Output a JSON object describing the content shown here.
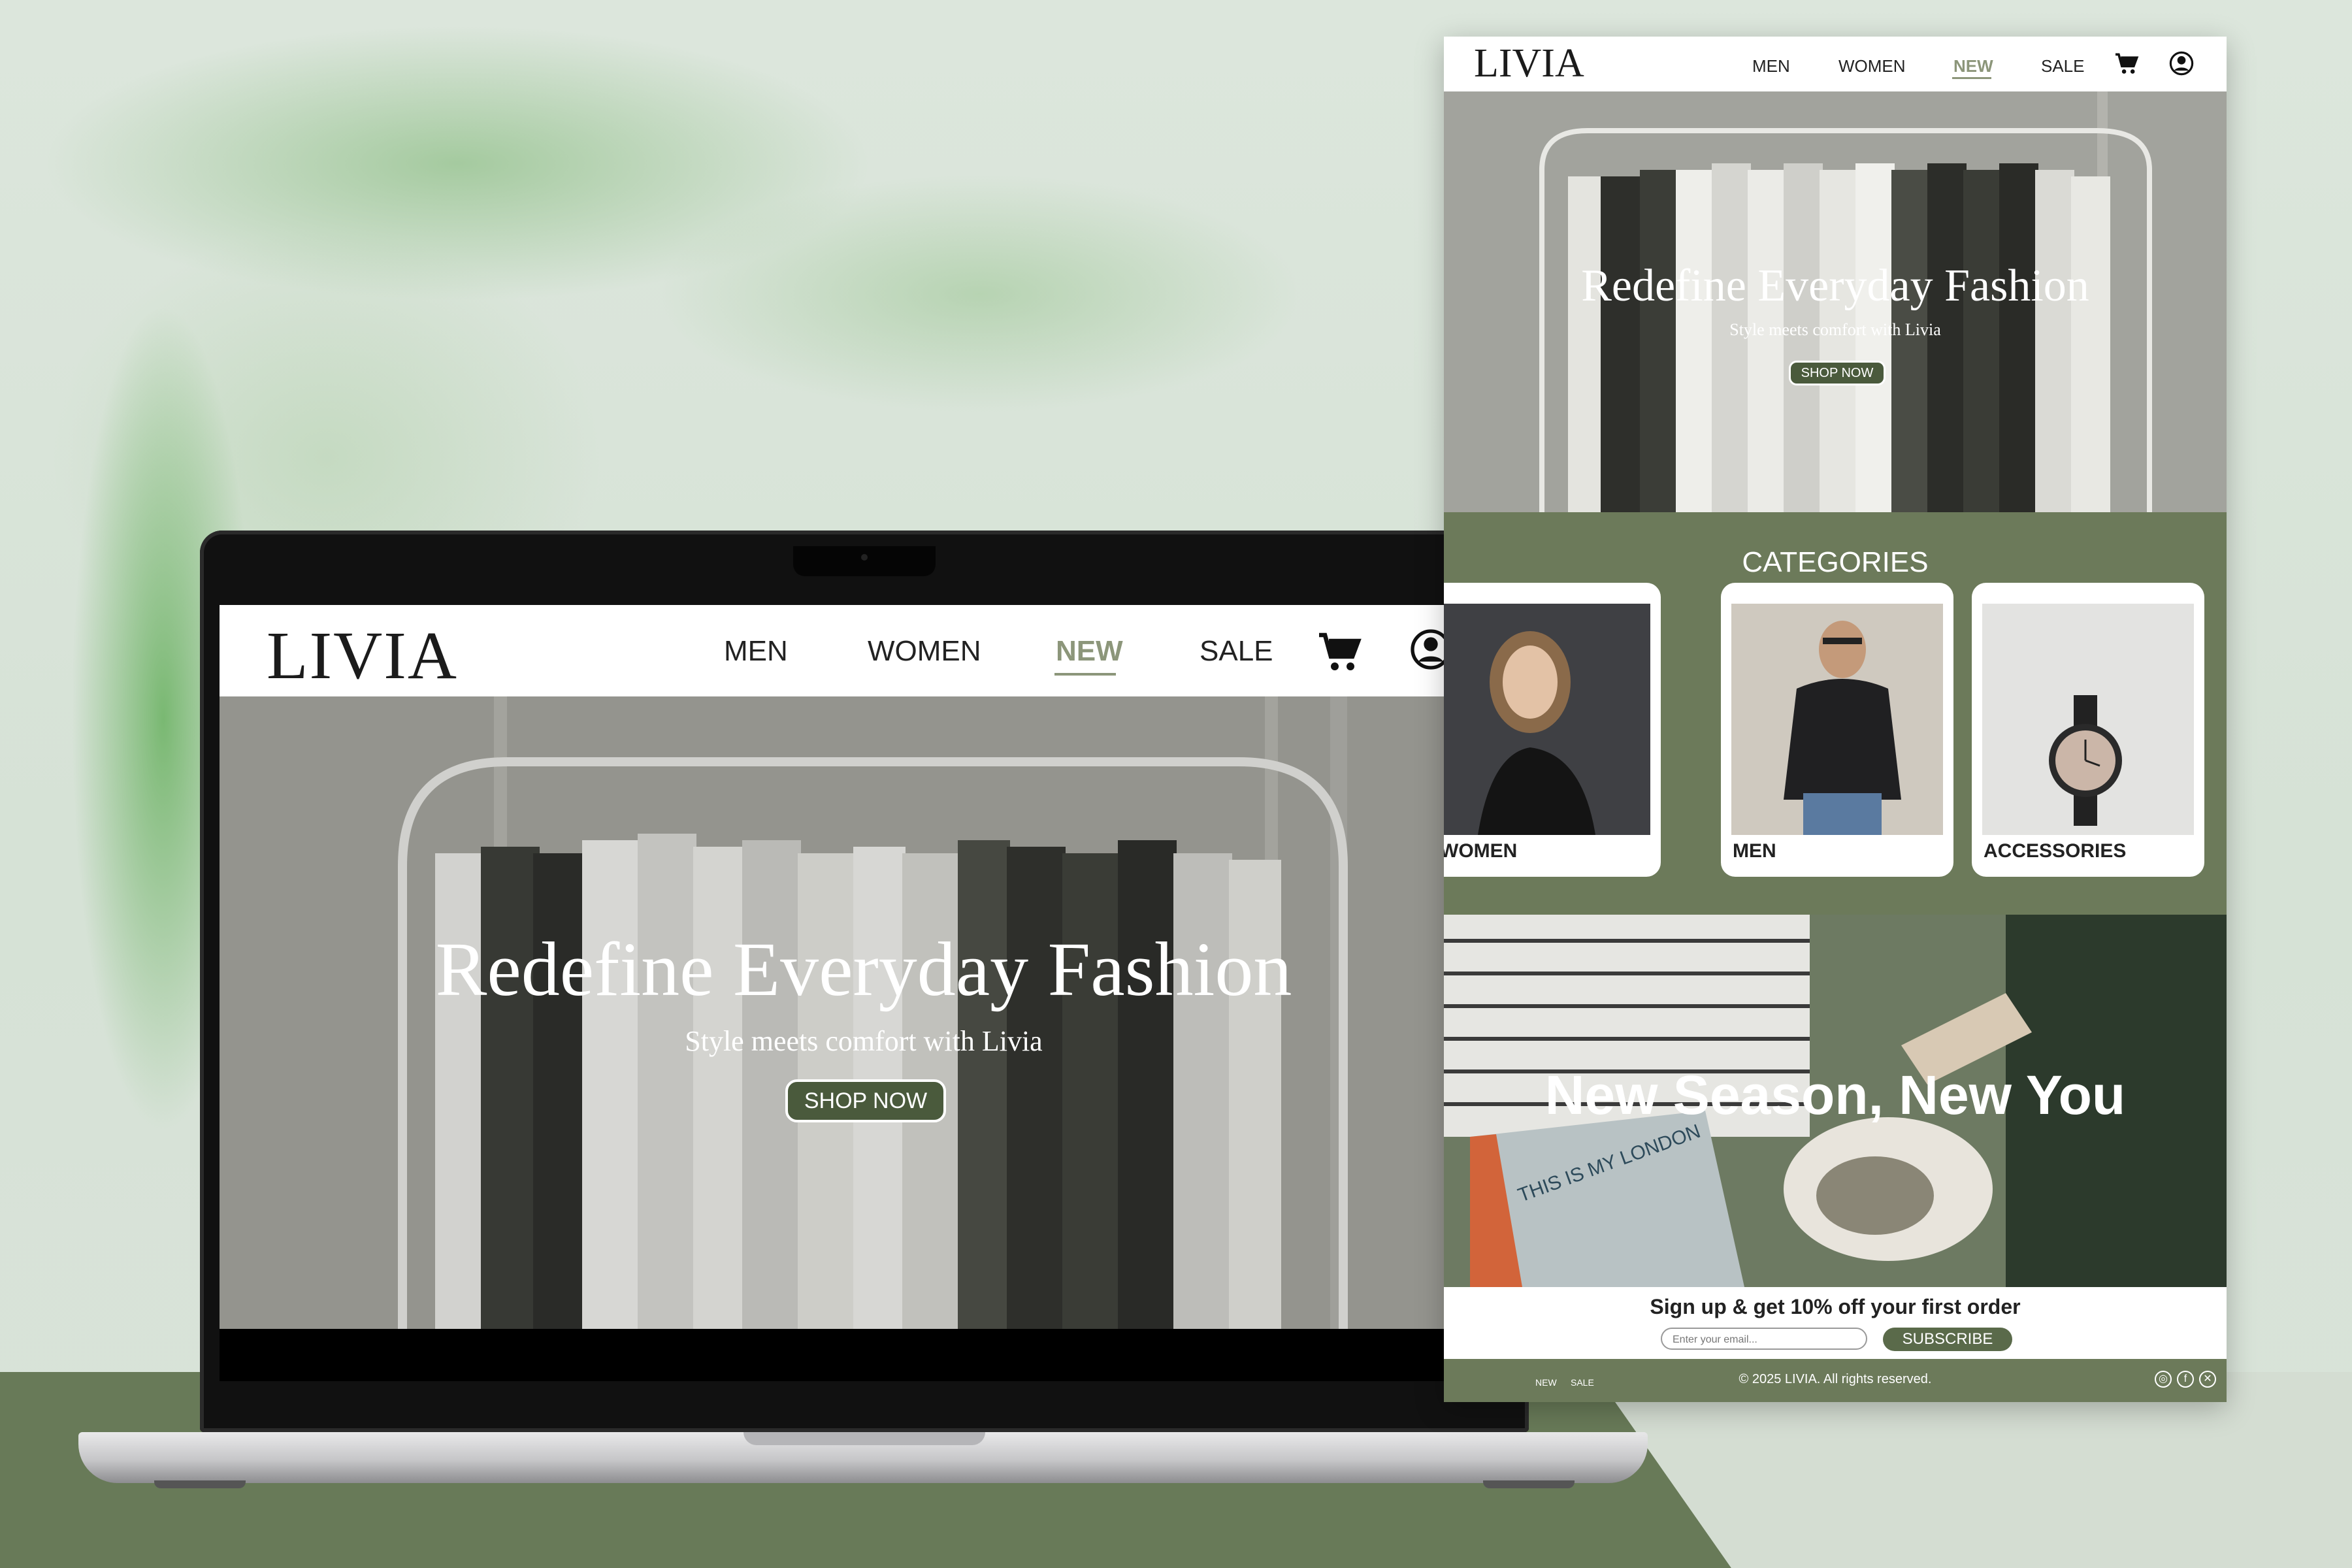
{
  "colors": {
    "accent": "#8c967a",
    "olive": "#6c7a5a",
    "button": "#4a5a3c"
  },
  "laptop": {
    "logo": "LIVIA",
    "nav": [
      "MEN",
      "WOMEN",
      "NEW",
      "SALE"
    ],
    "active_nav": "NEW",
    "icons": [
      "cart-icon",
      "user-icon"
    ],
    "hero": {
      "title": "Redefine Everyday Fashion",
      "subtitle": "Style meets comfort with Livia",
      "button": "SHOP NOW"
    }
  },
  "page": {
    "logo": "LIVIA",
    "nav": [
      "MEN",
      "WOMEN",
      "NEW",
      "SALE"
    ],
    "hero": {
      "title": "Redefine Everyday Fashion",
      "subtitle": "Style meets comfort with Livia",
      "button": "SHOP NOW"
    },
    "categories": {
      "title": "CATEGORIES",
      "items": [
        "WOMEN",
        "MEN",
        "ACCESSORIES"
      ]
    },
    "promo": {
      "title": "New Season, New You",
      "book_text": "THIS IS MY LONDON"
    },
    "signup": {
      "text": "Sign up & get 10% off your first order",
      "placeholder": "Enter your email...",
      "button": "SUBSCRIBE"
    },
    "footer": {
      "links": [
        "NEW",
        "SALE"
      ],
      "copyright": "© 2025 LIVIA. All rights reserved.",
      "social": [
        "instagram-icon",
        "facebook-icon",
        "x-icon"
      ]
    }
  }
}
